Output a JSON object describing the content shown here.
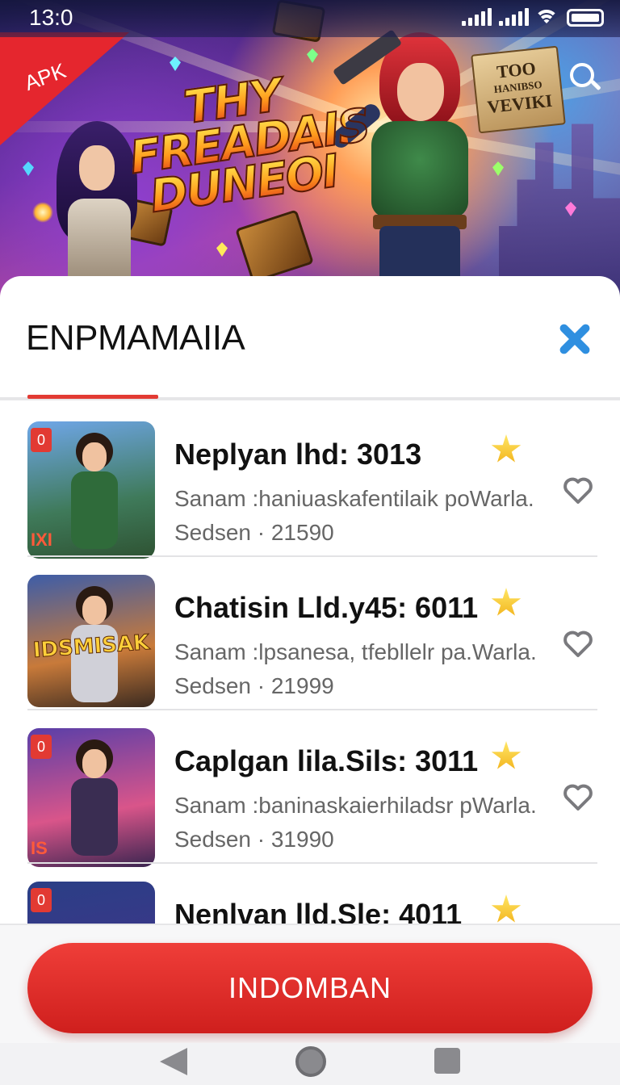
{
  "status_bar": {
    "time": "13:0",
    "icons": [
      "signal-icon",
      "signal-icon",
      "wifi-icon",
      "battery-icon"
    ]
  },
  "hero": {
    "badge": "APK",
    "logo_lines": [
      "THY",
      "FREADAIS",
      "DUNEOI"
    ],
    "sign_lines": [
      "TOO",
      "HANIBSO",
      "VEVIKI"
    ],
    "search_icon": "search-icon"
  },
  "sheet": {
    "title": "ENPMAMAIIA",
    "close_icon": "close-icon",
    "accent_color": "#e23a33",
    "close_color": "#2f8fe0"
  },
  "items": [
    {
      "title": "Neplyan lhd: 3013",
      "desc": "Sanam :haniuaskafentilaik poWarla.",
      "meta": "Sedsen · 21590",
      "badge": "0",
      "thumb_logo": "IXI",
      "thumb_text": ""
    },
    {
      "title": "Chatisin Lld.y45: 6011",
      "desc": "Sanam :lpsanesa, tfebllelr pa.Warla.",
      "meta": "Sedsen · 21999",
      "badge": "",
      "thumb_logo": "",
      "thumb_text": "IDSMISAK"
    },
    {
      "title": "Caplgan lila.Sils: 3011",
      "desc": "Sanam :baninaskaierhiladsr pWarla.",
      "meta": "Sedsen · 31990",
      "badge": "0",
      "thumb_logo": "IS",
      "thumb_text": ""
    },
    {
      "title": "Nenlvan lld.Sle: 4011",
      "desc": "",
      "meta": "",
      "badge": "0",
      "thumb_logo": "",
      "thumb_text": ""
    }
  ],
  "primary_button": {
    "label": "INDOMBAN",
    "color": "#e23a33"
  },
  "nav": {
    "back": "back-icon",
    "home": "home-icon",
    "recent": "recent-apps-icon"
  }
}
